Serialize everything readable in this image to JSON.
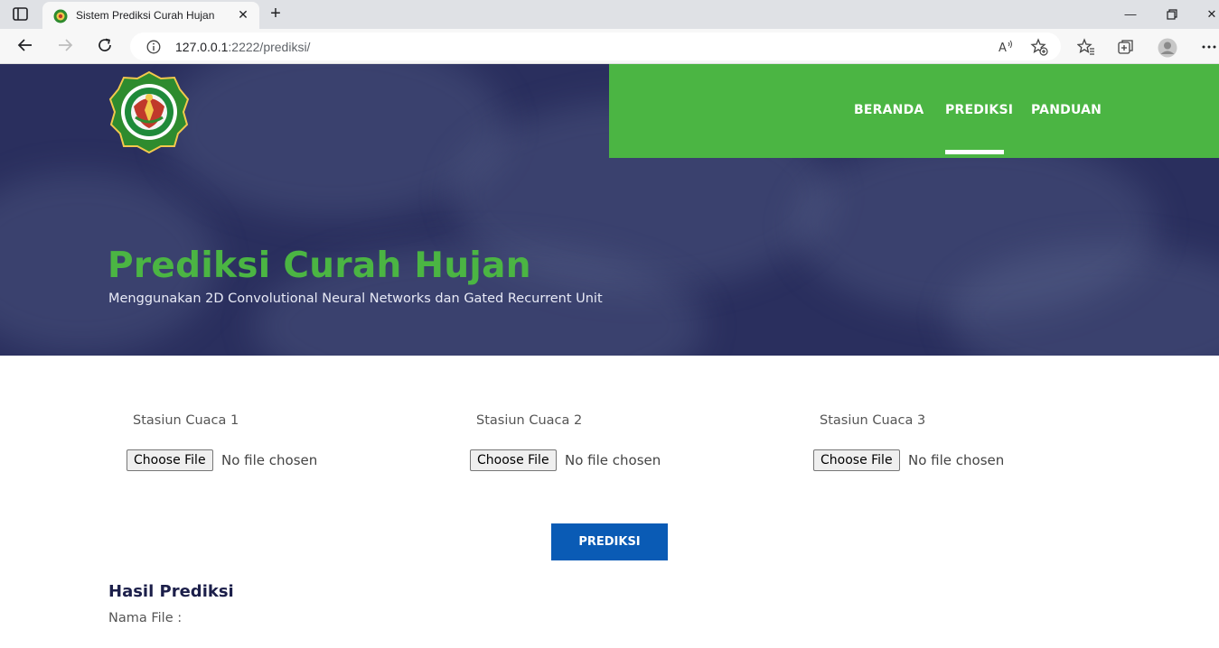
{
  "browser": {
    "tab_title": "Sistem Prediksi Curah Hujan",
    "url_host": "127.0.0.1",
    "url_rest": ":2222/prediksi/"
  },
  "nav": {
    "items": [
      {
        "label": "BERANDA",
        "active": false
      },
      {
        "label": "PREDIKSI",
        "active": true
      },
      {
        "label": "PANDUAN",
        "active": false
      }
    ]
  },
  "hero": {
    "title": "Prediksi Curah Hujan",
    "subtitle": "Menggunakan 2D Convolutional Neural Networks dan Gated Recurrent Unit"
  },
  "form": {
    "stations": [
      {
        "label": "Stasiun Cuaca 1",
        "button": "Choose File",
        "status": "No file chosen"
      },
      {
        "label": "Stasiun Cuaca 2",
        "button": "Choose File",
        "status": "No file chosen"
      },
      {
        "label": "Stasiun Cuaca 3",
        "button": "Choose File",
        "status": "No file chosen"
      }
    ],
    "submit_label": "PREDIKSI"
  },
  "result": {
    "title": "Hasil Prediksi",
    "file_label": "Nama File :"
  },
  "colors": {
    "brand_green": "#4bb543",
    "hero_navy": "#2a2f5e",
    "button_blue": "#0a5bb5"
  }
}
